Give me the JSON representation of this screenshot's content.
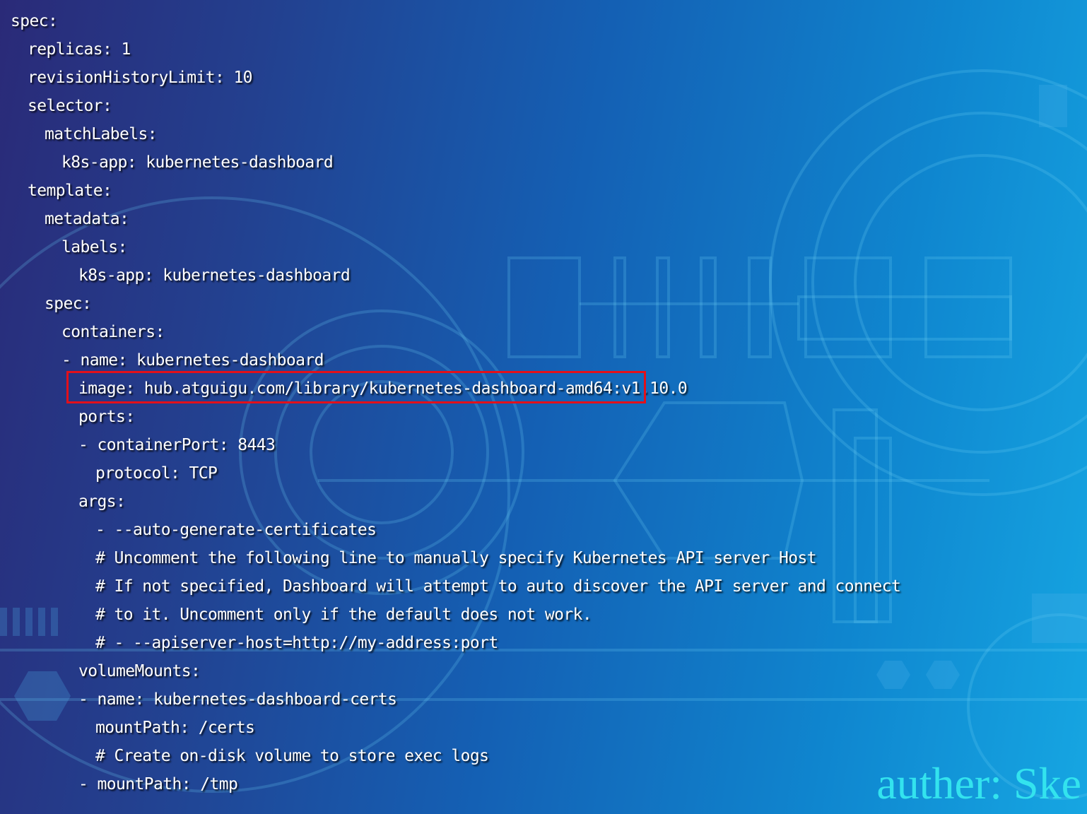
{
  "code": {
    "lines": [
      {
        "indent": 0,
        "text": "spec:"
      },
      {
        "indent": 1,
        "text": "replicas: 1"
      },
      {
        "indent": 1,
        "text": "revisionHistoryLimit: 10"
      },
      {
        "indent": 1,
        "text": "selector:"
      },
      {
        "indent": 2,
        "text": "matchLabels:"
      },
      {
        "indent": 3,
        "text": "k8s-app: kubernetes-dashboard"
      },
      {
        "indent": 1,
        "text": "template:"
      },
      {
        "indent": 2,
        "text": "metadata:"
      },
      {
        "indent": 3,
        "text": "labels:"
      },
      {
        "indent": 4,
        "text": "k8s-app: kubernetes-dashboard"
      },
      {
        "indent": 2,
        "text": "spec:"
      },
      {
        "indent": 3,
        "text": "containers:"
      },
      {
        "indent": 3,
        "text": "- name: kubernetes-dashboard"
      },
      {
        "indent": 4,
        "text": "image: hub.atguigu.com/library/kubernetes-dashboard-amd64:v1.10.0",
        "highlighted": true
      },
      {
        "indent": 4,
        "text": "ports:"
      },
      {
        "indent": 4,
        "text": "- containerPort: 8443"
      },
      {
        "indent": 5,
        "text": "protocol: TCP"
      },
      {
        "indent": 4,
        "text": "args:"
      },
      {
        "indent": 5,
        "text": "- --auto-generate-certificates"
      },
      {
        "indent": 5,
        "text": "# Uncomment the following line to manually specify Kubernetes API server Host"
      },
      {
        "indent": 5,
        "text": "# If not specified, Dashboard will attempt to auto discover the API server and connect"
      },
      {
        "indent": 5,
        "text": "# to it. Uncomment only if the default does not work."
      },
      {
        "indent": 5,
        "text": "# - --apiserver-host=http://my-address:port"
      },
      {
        "indent": 4,
        "text": "volumeMounts:"
      },
      {
        "indent": 4,
        "text": "- name: kubernetes-dashboard-certs"
      },
      {
        "indent": 5,
        "text": "mountPath: /certs"
      },
      {
        "indent": 5,
        "text": "# Create on-disk volume to store exec logs"
      },
      {
        "indent": 4,
        "text": "- mountPath: /tmp"
      }
    ]
  },
  "author_label": "auther: Ske",
  "colors": {
    "highlight_border": "#e3101a",
    "author_text": "#33e3ee",
    "code_text": "#ffffff"
  }
}
